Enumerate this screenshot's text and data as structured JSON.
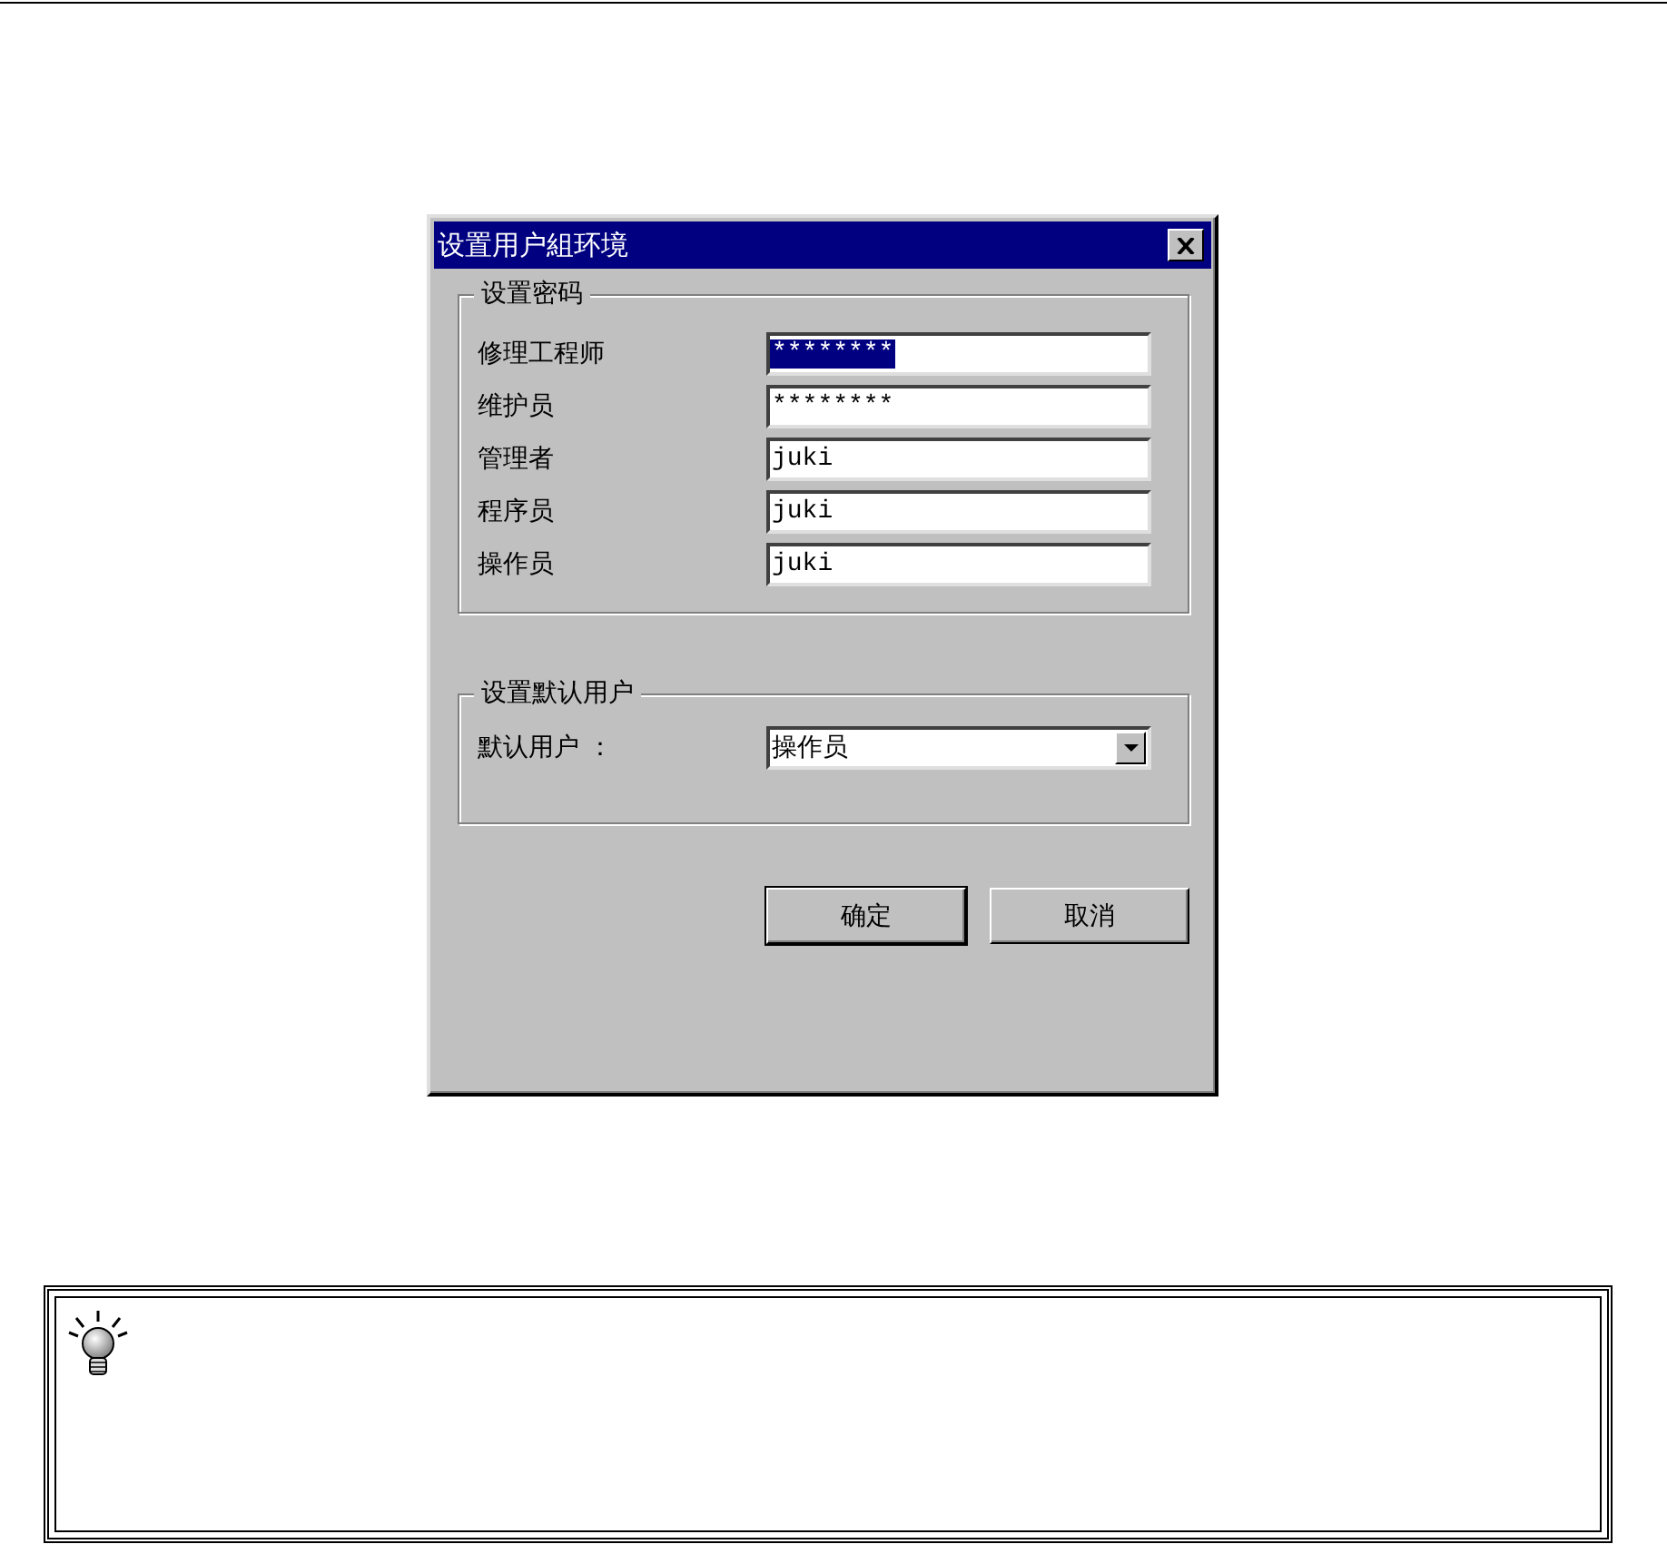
{
  "window": {
    "title": "设置用户組环境"
  },
  "password_group": {
    "title": "设置密码",
    "fields": [
      {
        "label": "修理工程师",
        "value": "********",
        "selected": true
      },
      {
        "label": "维护员",
        "value": "********",
        "selected": false
      },
      {
        "label": "管理者",
        "value": "juki",
        "selected": false
      },
      {
        "label": "程序员",
        "value": "juki",
        "selected": false
      },
      {
        "label": "操作员",
        "value": "juki",
        "selected": false
      }
    ]
  },
  "default_user_group": {
    "title": "设置默认用户",
    "label": "默认用户 ：",
    "value": "操作员"
  },
  "buttons": [
    "确定",
    "取消"
  ]
}
